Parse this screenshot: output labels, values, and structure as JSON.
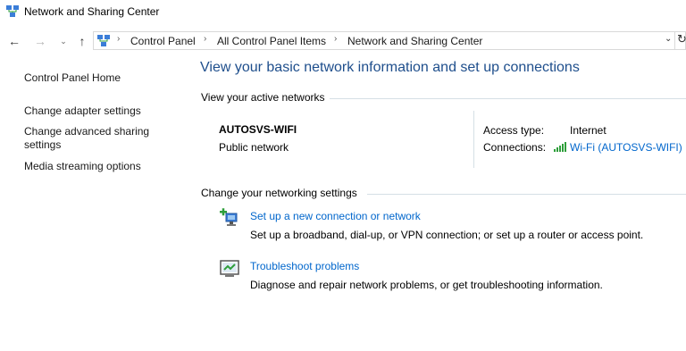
{
  "window": {
    "title": "Network and Sharing Center"
  },
  "nav": {
    "back_glyph": "←",
    "forward_glyph": "→",
    "recent_glyph": "⌄",
    "up_glyph": "↑",
    "breadcrumbs": [
      "Control Panel",
      "All Control Panel Items",
      "Network and Sharing Center"
    ],
    "separator": "›",
    "dropdown_glyph": "⌄",
    "refresh_glyph": "↻"
  },
  "sidebar": {
    "home": "Control Panel Home",
    "items": [
      "Change adapter settings",
      "Change advanced sharing settings",
      "Media streaming options"
    ]
  },
  "main": {
    "heading": "View your basic network information and set up connections",
    "active_networks_label": "View your active networks",
    "network": {
      "name": "AUTOSVS-WIFI",
      "type": "Public network",
      "access_type_label": "Access type:",
      "access_type_value": "Internet",
      "connections_label": "Connections:",
      "connection_link": "Wi-Fi (AUTOSVS-WIFI)"
    },
    "change_settings_label": "Change your networking settings",
    "tasks": [
      {
        "title": "Set up a new connection or network",
        "description": "Set up a broadband, dial-up, or VPN connection; or set up a router or access point."
      },
      {
        "title": "Troubleshoot problems",
        "description": "Diagnose and repair network problems, or get troubleshooting information."
      }
    ]
  },
  "colors": {
    "heading": "#1e4e8c",
    "link": "#0066cc",
    "wifi_signal": "#2e9e3a",
    "divider": "#d5dfe5"
  },
  "icons": {
    "title": "network-center-icon",
    "address": "network-center-icon",
    "signal": "wifi-signal-icon",
    "task_new_connection": "new-connection-icon",
    "task_troubleshoot": "troubleshoot-icon"
  }
}
